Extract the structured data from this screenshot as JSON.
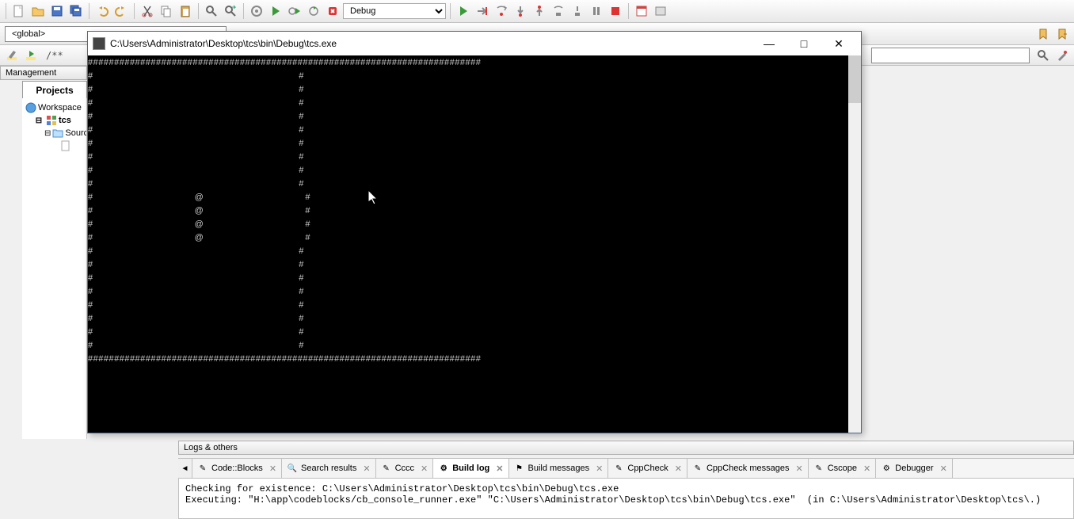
{
  "toolbar": {
    "build_config": "Debug"
  },
  "toolbar2": {
    "scope": "<global>",
    "isearch_placeholder": ""
  },
  "management": {
    "title": "Management",
    "tab": "Projects"
  },
  "tree": {
    "workspace": "Workspace",
    "project": "tcs",
    "sources": "Sources"
  },
  "console": {
    "title": "C:\\Users\\Administrator\\Desktop\\tcs\\bin\\Debug\\tcs.exe",
    "output": "###########################################################################\n#                                                                         #\n#                                                                         #\n#                                                                         #\n#                                                                         #\n#                                                                         #\n#                                                                         #\n#                                                                         #\n#                                                                         #\n#                                                                         #\n#                                    @                                    #\n#                                    @                                    #\n#                                    @                                    #\n#                                    @                                    #\n#                                                                         #\n#                                                                         #\n#                                                                         #\n#                                                                         #\n#                                                                         #\n#                                                                         #\n#                                                                         #\n#                                                                         #\n###########################################################################"
  },
  "logs": {
    "header": "Logs & others",
    "tabs": [
      {
        "label": "Code::Blocks"
      },
      {
        "label": "Search results"
      },
      {
        "label": "Cccc"
      },
      {
        "label": "Build log"
      },
      {
        "label": "Build messages"
      },
      {
        "label": "CppCheck"
      },
      {
        "label": "CppCheck messages"
      },
      {
        "label": "Cscope"
      },
      {
        "label": "Debugger"
      }
    ],
    "body": "Checking for existence: C:\\Users\\Administrator\\Desktop\\tcs\\bin\\Debug\\tcs.exe\nExecuting: \"H:\\app\\codeblocks/cb_console_runner.exe\" \"C:\\Users\\Administrator\\Desktop\\tcs\\bin\\Debug\\tcs.exe\"  (in C:\\Users\\Administrator\\Desktop\\tcs\\.)"
  }
}
